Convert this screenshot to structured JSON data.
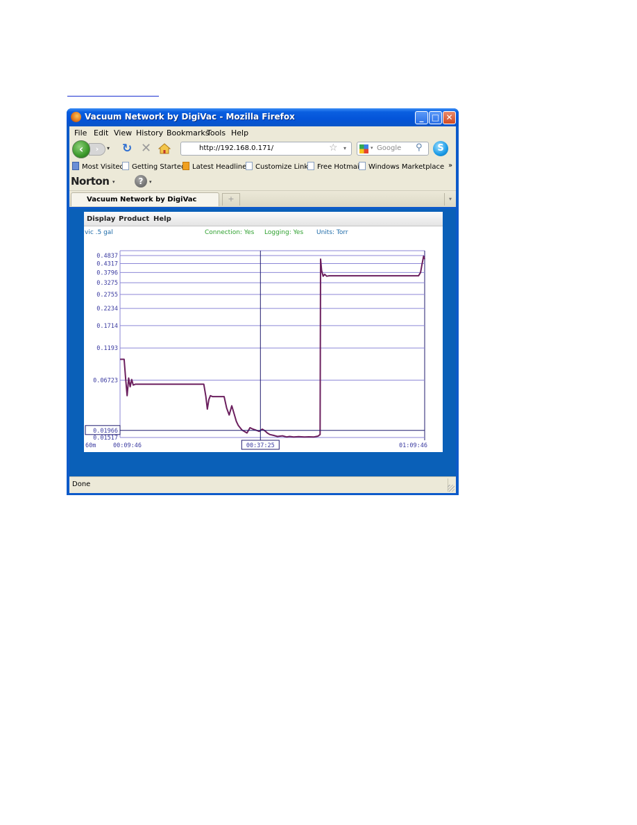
{
  "window": {
    "title": "Vacuum Network by DigiVac - Mozilla Firefox",
    "controls": {
      "minimize": "_",
      "maximize": "□",
      "close": "✕"
    }
  },
  "menubar": [
    "File",
    "Edit",
    "View",
    "History",
    "Bookmarks",
    "Tools",
    "Help"
  ],
  "navbar": {
    "back_icon": "‹",
    "forward_icon": "›",
    "dropdown_icon": "▾",
    "reload_icon": "↻",
    "stop_icon": "✕",
    "url": "http://192.168.0.171/",
    "bookmark_star_icon": "☆",
    "search_placeholder": "Google",
    "search_icon": "⚲",
    "skype_icon": "S"
  },
  "bookmarks": [
    "Most Visited",
    "Getting Started",
    "Latest Headlines",
    "Customize Links",
    "Free Hotmail",
    "Windows Marketplace"
  ],
  "bookmarks_overflow": "»",
  "norton": {
    "label": "Norton",
    "dropdown": "▾",
    "help_icon": "?"
  },
  "tabs": [
    {
      "label": "Vacuum Network by DigiVac",
      "active": true
    }
  ],
  "new_tab_icon": "+",
  "tab_list_icon": "▾",
  "app": {
    "menu": [
      "Display",
      "Product",
      "Help"
    ],
    "sensor_name": "vic .5 gal",
    "connection": "Connection: Yes",
    "logging": "Logging: Yes",
    "units": "Units: Torr",
    "colors": {
      "trace": "#6b1f5e",
      "grid": "#8b86d6",
      "axis_text": "#3a3aa0",
      "cursor": "#1f1a6e",
      "status_green": "#2ea02e",
      "units_blue": "#1d6aa8"
    }
  },
  "chart_data": {
    "type": "line",
    "title": "",
    "xlabel": "",
    "ylabel": "",
    "time_span_label": "60m",
    "x_ticks": [
      "00:09:46",
      "01:09:46"
    ],
    "x_range_minutes": [
      0,
      60
    ],
    "cursor": {
      "time": "00:37:25",
      "time_minutes": 27.65,
      "value": "0.01966"
    },
    "y_ticks": [
      "0.4837",
      "0.4317",
      "0.3796",
      "0.3275",
      "0.2755",
      "0.2234",
      "0.1714",
      "0.1193",
      "0.06723",
      "0.01517"
    ],
    "y_tick_values": [
      0.4837,
      0.4317,
      0.3796,
      0.3275,
      0.2755,
      0.2234,
      0.1714,
      0.1193,
      0.06723,
      0.01517
    ],
    "y_range": [
      0.01517,
      0.4837
    ],
    "grid": true,
    "series": [
      {
        "name": "vic .5 gal",
        "x_minutes": [
          0,
          0.8,
          1.1,
          1.4,
          1.7,
          2.0,
          2.3,
          2.6,
          3.0,
          5,
          10,
          15,
          16.5,
          16.9,
          17.2,
          17.5,
          17.8,
          18.2,
          20.5,
          21.0,
          21.5,
          22.0,
          22.4,
          22.9,
          23.3,
          24.0,
          25.0,
          25.6,
          26.2,
          26.8,
          27.4,
          28.0,
          28.5,
          29.0,
          29.5,
          30.2,
          31.0,
          32.0,
          32.8,
          33.4,
          34.2,
          35.2,
          36.3,
          37.2,
          38.2,
          39.0,
          39.4,
          39.5,
          39.7,
          40.0,
          40.3,
          40.7,
          41.2,
          45,
          50,
          55,
          58.8,
          59.2,
          59.5,
          59.8,
          60
        ],
        "values": [
          0.0984,
          0.0984,
          0.07,
          0.049,
          0.07,
          0.059,
          0.068,
          0.061,
          0.062,
          0.062,
          0.062,
          0.062,
          0.062,
          0.048,
          0.036,
          0.045,
          0.049,
          0.048,
          0.048,
          0.037,
          0.031,
          0.039,
          0.033,
          0.026,
          0.023,
          0.02,
          0.018,
          0.0215,
          0.0205,
          0.0198,
          0.019,
          0.0205,
          0.0195,
          0.018,
          0.017,
          0.0165,
          0.0158,
          0.0162,
          0.0155,
          0.0158,
          0.0155,
          0.0157,
          0.0155,
          0.0156,
          0.0155,
          0.016,
          0.017,
          0.46,
          0.39,
          0.36,
          0.37,
          0.36,
          0.362,
          0.362,
          0.362,
          0.362,
          0.362,
          0.38,
          0.43,
          0.48,
          0.46
        ]
      }
    ]
  },
  "status": "Done"
}
